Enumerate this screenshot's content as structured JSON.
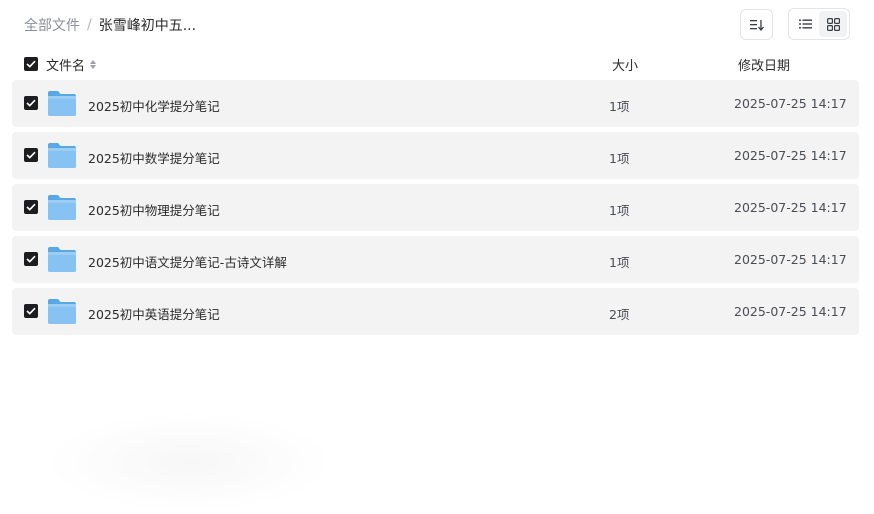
{
  "breadcrumb": {
    "root": "全部文件",
    "separator": "/",
    "current": "张雪峰初中五..."
  },
  "toolbar": {
    "sort_icon": "sort-icon",
    "list_view_icon": "list-view-icon",
    "grid_view_icon": "grid-view-icon"
  },
  "columns": {
    "name": "文件名",
    "size": "大小",
    "date": "修改日期"
  },
  "files": [
    {
      "name": "2025初中化学提分笔记",
      "size": "1项",
      "date": "2025-07-25 14:17",
      "checked": true
    },
    {
      "name": "2025初中数学提分笔记",
      "size": "1项",
      "date": "2025-07-25 14:17",
      "checked": true
    },
    {
      "name": "2025初中物理提分笔记",
      "size": "1项",
      "date": "2025-07-25 14:17",
      "checked": true
    },
    {
      "name": "2025初中语文提分笔记-古诗文详解",
      "size": "1项",
      "date": "2025-07-25 14:17",
      "checked": true
    },
    {
      "name": "2025初中英语提分笔记",
      "size": "2项",
      "date": "2025-07-25 14:17",
      "checked": true
    }
  ],
  "colors": {
    "row_bg": "#f3f3f4",
    "checkbox": "#1d1d1f",
    "folder": "#7fbef0"
  }
}
